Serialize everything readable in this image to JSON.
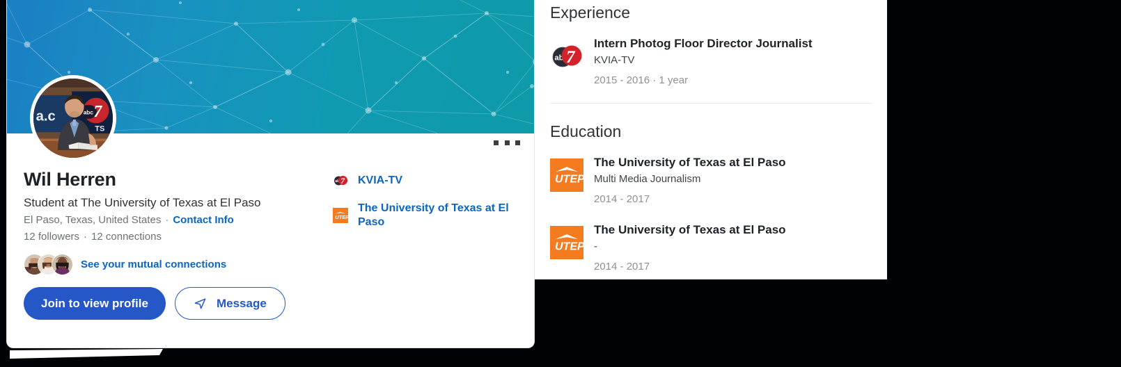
{
  "profile": {
    "name": "Wil Herren",
    "headline": "Student at The University of Texas at El Paso",
    "location": "El Paso, Texas, United States",
    "separator": "·",
    "contact_info_label": "Contact Info",
    "followers": "12 followers",
    "connections": "12 connections",
    "mutual_connections_label": "See your mutual connections",
    "more_actions_label": "...",
    "buttons": {
      "primary": "Join to view profile",
      "secondary": "Message"
    },
    "links": [
      {
        "label": "KVIA-TV",
        "icon": "abc7-logo-icon"
      },
      {
        "label": "The University of Texas at El Paso",
        "icon": "utep-logo-icon"
      }
    ]
  },
  "experience": {
    "title": "Experience",
    "items": [
      {
        "title": "Intern Photog Floor Director Journalist",
        "company": "KVIA-TV",
        "dates": "2015 - 2016  · 1 year",
        "icon": "abc7-logo-icon"
      }
    ]
  },
  "education": {
    "title": "Education",
    "items": [
      {
        "school": "The University of Texas at El Paso",
        "degree": "Multi Media Journalism",
        "dates": "2014 - 2017",
        "icon": "utep-logo-icon"
      },
      {
        "school": "The University of Texas at El Paso",
        "degree": "-",
        "dates": "2014 - 2017",
        "icon": "utep-logo-icon"
      }
    ]
  },
  "colors": {
    "link_blue": "#0a66c2",
    "button_blue": "#2557c7",
    "banner_start": "#1b7fc4",
    "banner_end": "#0e9aa8",
    "utep_orange": "#f47b20",
    "text_dark": "#1d2226",
    "text_muted": "#6b7276"
  }
}
